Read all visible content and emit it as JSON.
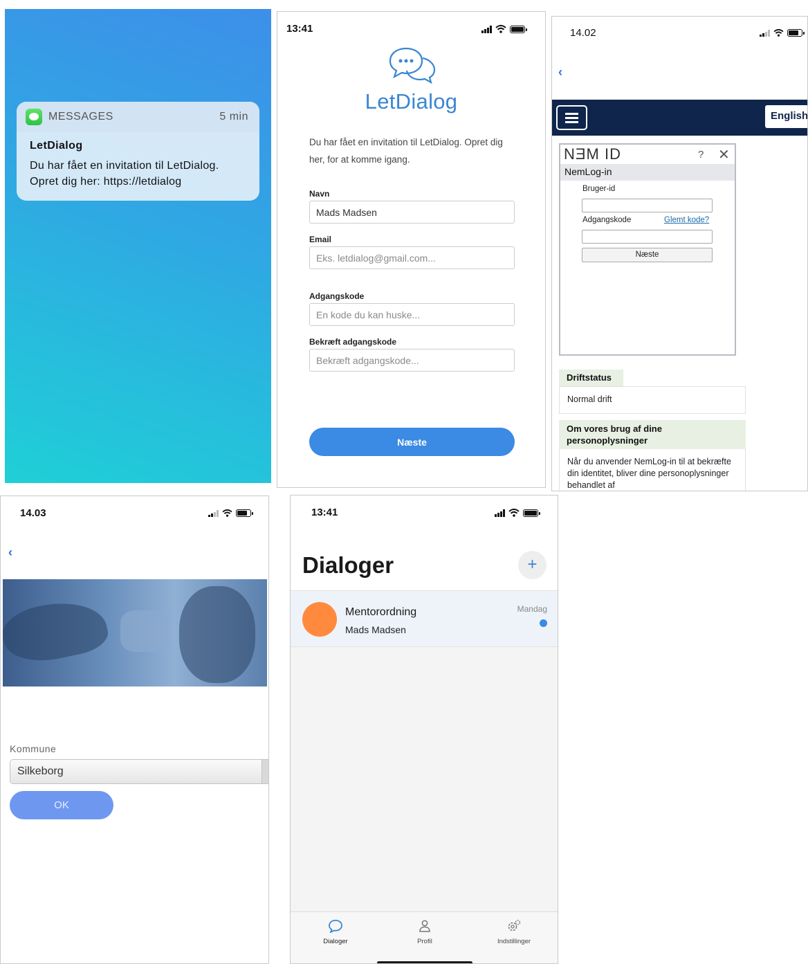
{
  "panel1": {
    "notification": {
      "app": "MESSAGES",
      "time": "5 min",
      "title": "LetDialog",
      "body": "Du har fået en invitation til LetDialog. Opret dig her: https://letdialog"
    }
  },
  "panel2": {
    "status_time": "13:41",
    "brand": "LetDialog",
    "intro": "Du har fået en invitation til LetDialog. Opret dig her, for at komme igang.",
    "fields": [
      {
        "label": "Navn",
        "value": "Mads Madsen",
        "placeholder": ""
      },
      {
        "label": "Email",
        "value": "",
        "placeholder": "Eks. letdialog@gmail.com..."
      },
      {
        "label": "Adgangskode",
        "value": "",
        "placeholder": "En kode du kan huske..."
      },
      {
        "label": "Bekræft adgangskode",
        "value": "",
        "placeholder": "Bekræft adgangskode..."
      }
    ],
    "next_label": "Næste",
    "accent": "#3b8ae3"
  },
  "panel3": {
    "status_time": "14.02",
    "back_glyph": "‹",
    "lang_label": "English",
    "nemid": {
      "logo": "NƎM ID",
      "help": "?",
      "close": "✕",
      "subtitle": "NemLog-in",
      "user_label": "Bruger-id",
      "password_label": "Adgangskode",
      "forgot_link": "Glemt kode?",
      "next_label": "Næste"
    },
    "driftstatus_title": "Driftstatus",
    "driftstatus_value": "Normal drift",
    "privacy_title": "Om vores brug af dine personoplysninger",
    "privacy_text": "Når du anvender NemLog-in til at bekræfte din identitet, bliver dine personoplysninger behandlet af",
    "navbar_color": "#10254b"
  },
  "panel4": {
    "status_time": "14.03",
    "back_glyph": "‹",
    "kommune_label": "Kommune",
    "kommune_value": "Silkeborg",
    "ok_label": "OK"
  },
  "panel5": {
    "status_time": "13:41",
    "title": "Dialoger",
    "add_glyph": "+",
    "dialogs": [
      {
        "title": "Mentorordning",
        "subtitle": "Mads Madsen",
        "time": "Mandag",
        "unread": true
      }
    ],
    "tabs": [
      {
        "label": "Dialoger",
        "icon": "chat-bubble-icon",
        "active": true
      },
      {
        "label": "Profil",
        "icon": "person-icon",
        "active": false
      },
      {
        "label": "Indstillinger",
        "icon": "gear-icon",
        "active": false
      }
    ],
    "avatar_color": "#ff8a3d"
  }
}
